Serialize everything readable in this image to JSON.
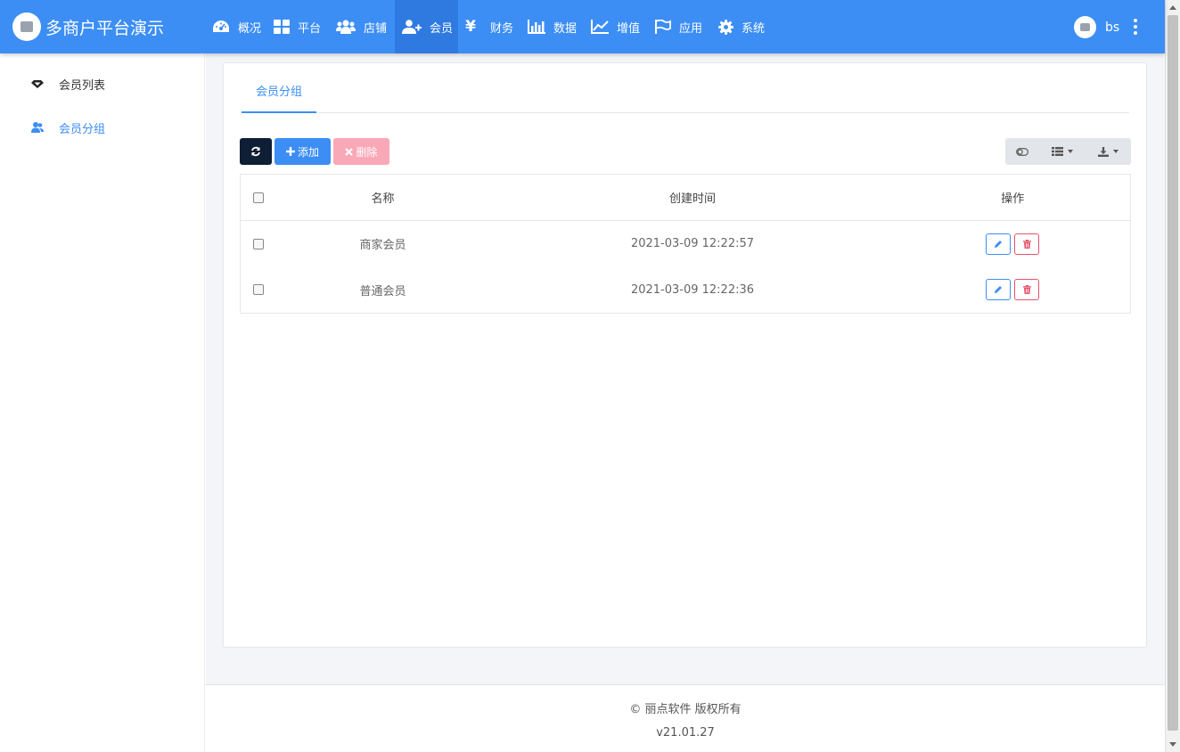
{
  "app": {
    "title": "多商户平台演示",
    "accent_color": "#3c8ef5",
    "danger_color": "#e5536b"
  },
  "nav": {
    "items": [
      {
        "label": "概况",
        "icon": "dashboard-icon"
      },
      {
        "label": "平台",
        "icon": "grid-icon"
      },
      {
        "label": "店铺",
        "icon": "users-icon"
      },
      {
        "label": "会员",
        "icon": "user-plus-icon",
        "active": true
      },
      {
        "label": "财务",
        "icon": "yen-icon",
        "glyph": "¥"
      },
      {
        "label": "数据",
        "icon": "bar-chart-icon"
      },
      {
        "label": "增值",
        "icon": "line-chart-icon"
      },
      {
        "label": "应用",
        "icon": "flag-icon"
      },
      {
        "label": "系统",
        "icon": "gear-icon"
      }
    ]
  },
  "user": {
    "name": "bs"
  },
  "sidebar": {
    "items": [
      {
        "label": "会员列表",
        "icon": "diamond-icon"
      },
      {
        "label": "会员分组",
        "icon": "users-icon",
        "active": true
      }
    ]
  },
  "tabs": [
    {
      "label": "会员分组",
      "active": true
    }
  ],
  "toolbar": {
    "add_label": "添加",
    "delete_label": "删除"
  },
  "table": {
    "columns": [
      "名称",
      "创建时间",
      "操作"
    ],
    "rows": [
      {
        "name": "商家会员",
        "created": "2021-03-09 12:22:57"
      },
      {
        "name": "普通会员",
        "created": "2021-03-09 12:22:36"
      }
    ]
  },
  "footer": {
    "copyright": "© 丽点软件 版权所有",
    "version": "v21.01.27"
  }
}
